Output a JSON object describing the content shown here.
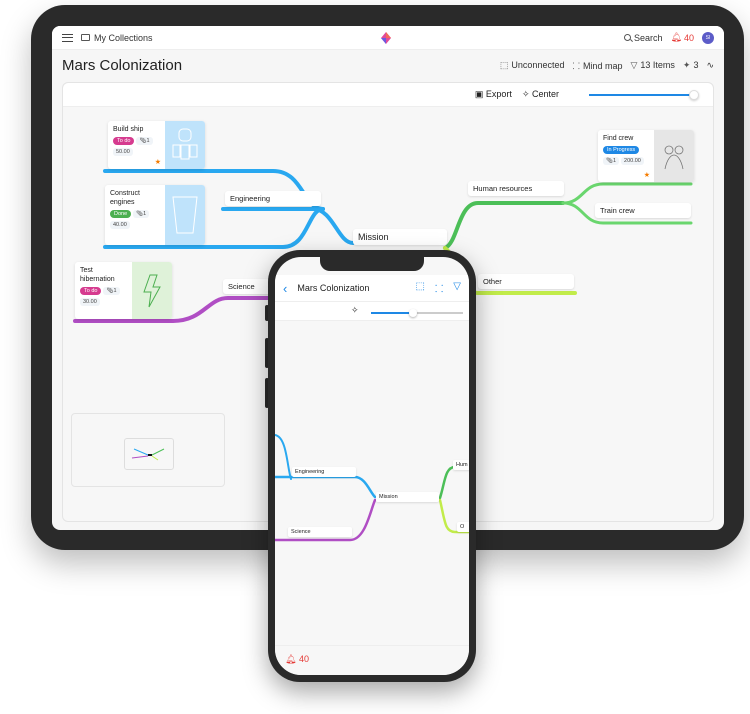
{
  "tablet": {
    "breadcrumb": "My Collections",
    "search_label": "Search",
    "notification_count": "40",
    "avatar_initials": "SI",
    "page_title": "Mars Colonization",
    "actions": {
      "unconnected": "Unconnected",
      "mind_map": "Mind map",
      "items": "13 Items",
      "collaborators": "3"
    },
    "toolbar": {
      "export": "Export",
      "center": "Center",
      "zoom_level": 1.0
    },
    "mindmap": {
      "root": "Mission",
      "branches": [
        {
          "label": "Engineering",
          "color": "#29a8f0"
        },
        {
          "label": "Science",
          "color": "#b04ec4"
        },
        {
          "label": "Human resources",
          "color": "#4cbf58"
        },
        {
          "label": "Other",
          "color": "#c2ec4a"
        }
      ],
      "leaves": {
        "train_crew": "Train crew"
      },
      "cards": [
        {
          "title": "Build ship",
          "status": "To do",
          "status_color": "#d63b8f",
          "attachments": "1",
          "value": "50.00",
          "starred": true
        },
        {
          "title": "Construct engines",
          "status": "Done",
          "status_color": "#4caf50",
          "attachments": "1",
          "value": "40.00",
          "starred": false
        },
        {
          "title": "Test hibernation",
          "status": "To do",
          "status_color": "#d63b8f",
          "attachments": "1",
          "value": "30.00",
          "starred": false
        },
        {
          "title": "Find crew",
          "status": "In Progress",
          "status_color": "#1e88e5",
          "attachments": "1",
          "value": "200.00",
          "starred": true
        }
      ]
    }
  },
  "phone": {
    "title": "Mars Colonization",
    "zoom_level": 0.45,
    "nodes": {
      "engineering": "Engineering",
      "science": "Science",
      "mission": "Mission",
      "human": "Hum",
      "other": "O"
    },
    "notification_count": "40"
  }
}
